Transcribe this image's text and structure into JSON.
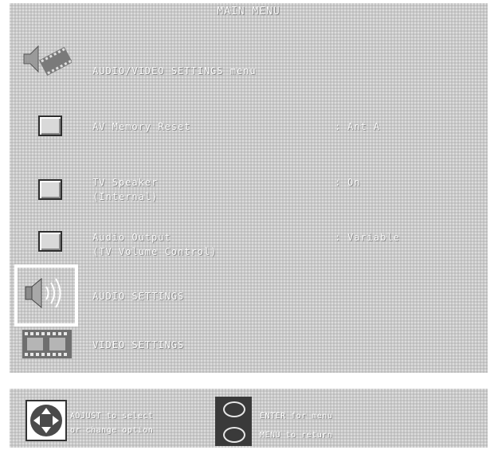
{
  "title": "MAIN MENU",
  "menu": {
    "items": [
      {
        "label": "AUDIO/VIDEO SETTINGS menu",
        "icon": "audio-video-icon"
      },
      {
        "label": "AV Memory Reset",
        "value": "Ant A",
        "icon": "checkbox-icon"
      },
      {
        "label": "TV Speaker",
        "sublabel": "(Internal)",
        "value": "On",
        "icon": "checkbox-icon"
      },
      {
        "label": "Audio Output",
        "sublabel": "(TV Volume Control)",
        "value": "Variable",
        "icon": "checkbox-icon"
      },
      {
        "label": "AUDIO SETTINGS",
        "icon": "speaker-icon",
        "selected": true
      },
      {
        "label": "VIDEO SETTINGS",
        "icon": "film-icon"
      }
    ],
    "separator": ":"
  },
  "footer": {
    "adjust_line1": "ADJUST to select",
    "adjust_line2": "or change option",
    "enter_line": "ENTER for menu",
    "menu_line": "MENU to return"
  },
  "colors": {
    "panel": "#c9c9c9",
    "text": "#ffffff",
    "selection_frame": "#ffffff",
    "button_panel": "#3a3a3a"
  }
}
